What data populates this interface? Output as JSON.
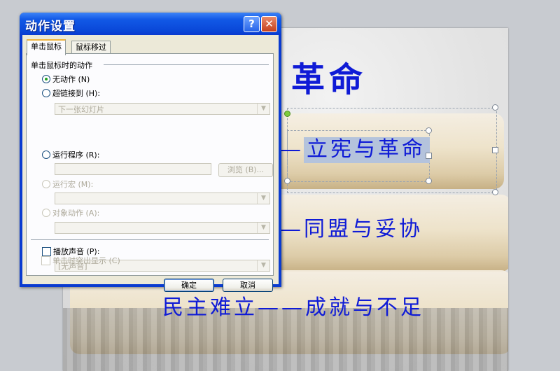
{
  "slide": {
    "title": "革命",
    "line1_prefix": "—",
    "line1": "立宪与革命",
    "line2": "—同盟与妥协",
    "line3": "民主难立——成就与不足"
  },
  "dialog": {
    "title": "动作设置",
    "help_label": "?",
    "close_label": "✕",
    "tabs": [
      "单击鼠标",
      "鼠标移过"
    ],
    "group_label": "单击鼠标时的动作",
    "options": {
      "none": "无动作 (N)",
      "hyperlink": "超链接到 (H):",
      "hyperlink_value": "下一张幻灯片",
      "run_program": "运行程序 (R):",
      "browse": "浏览 (B)...",
      "run_macro": "运行宏 (M):",
      "object_action": "对象动作 (A):"
    },
    "sound": {
      "play_sound": "播放声音 (P):",
      "sound_value": "[无声音]",
      "highlight": "单击时突出显示 (C)"
    },
    "ok_label": "确定",
    "cancel_label": "取消"
  }
}
